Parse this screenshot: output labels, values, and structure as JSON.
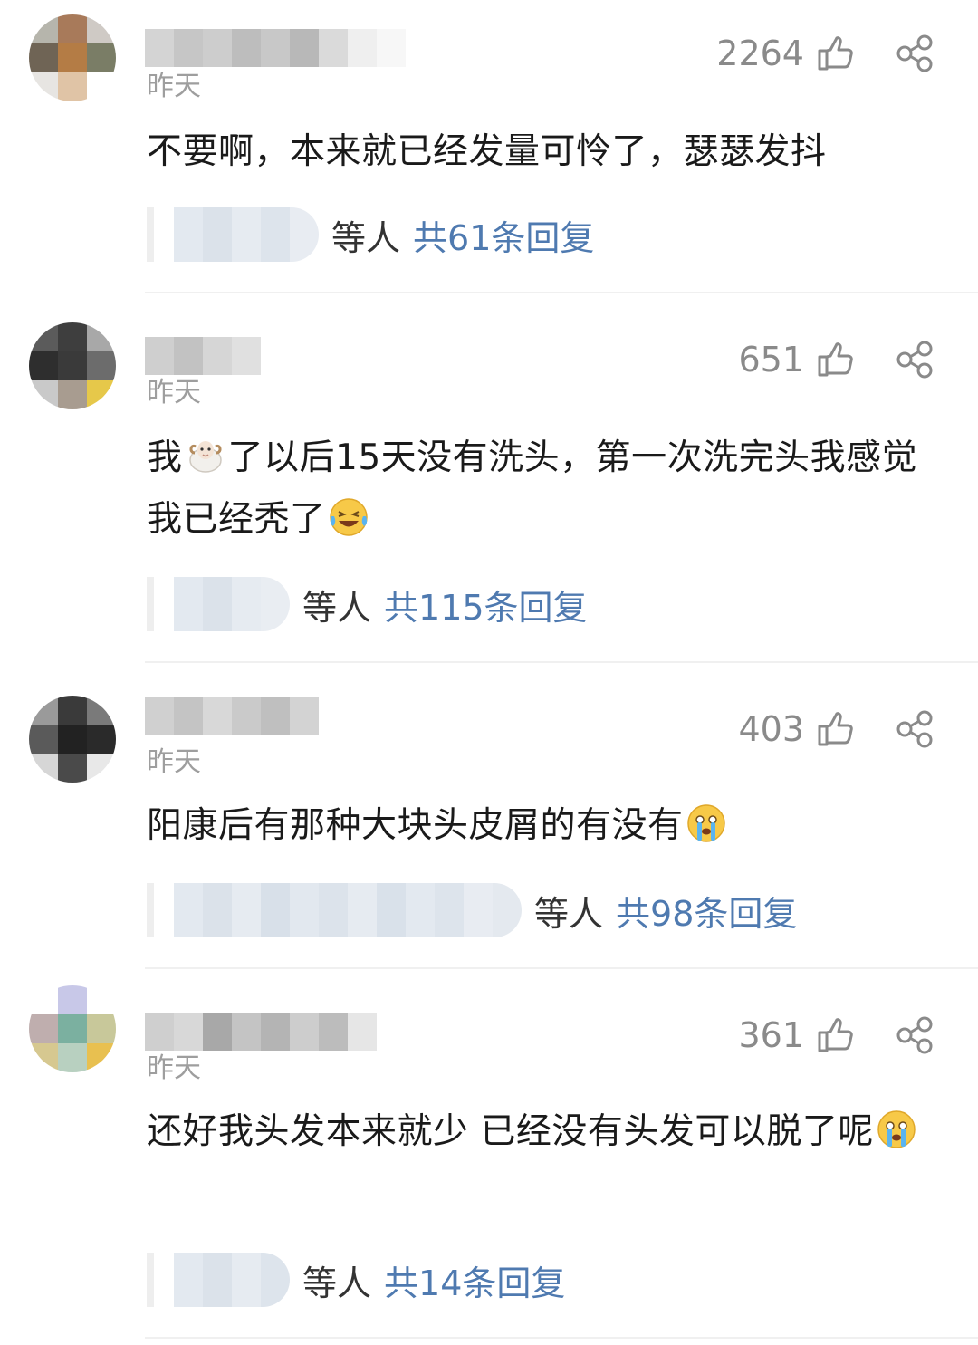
{
  "comments": [
    {
      "time": "昨天",
      "likes": "2264",
      "text_parts": [
        "不要啊，本来就已经发量可怜了，瑟瑟发抖"
      ],
      "reply_suffix": "等人",
      "reply_count": "共61条回复"
    },
    {
      "time": "昨天",
      "likes": "651",
      "text_parts": [
        "我",
        "了以后15天没有洗头，第一次洗完头我感觉我已经秃了"
      ],
      "emojis": [
        "sheep-emoji",
        "laughing-crying-emoji"
      ],
      "reply_suffix": "等人",
      "reply_count": "共115条回复"
    },
    {
      "time": "昨天",
      "likes": "403",
      "text_parts": [
        "阳康后有那种大块头皮屑的有没有"
      ],
      "emojis": [
        "crying-emoji"
      ],
      "reply_suffix": "等人",
      "reply_count": "共98条回复"
    },
    {
      "time": "昨天",
      "likes": "361",
      "text_parts": [
        "还好我头发本来就少 已经没有头发可以脱了呢"
      ],
      "emojis": [
        "crying-emoji"
      ],
      "reply_suffix": "等人",
      "reply_count": "共14条回复"
    }
  ],
  "icons": {
    "like": "thumbs-up-icon",
    "share": "share-icon"
  },
  "colors": {
    "link": "#4f7ab0",
    "muted": "#9e9e9e",
    "text": "#1a1a1a"
  }
}
